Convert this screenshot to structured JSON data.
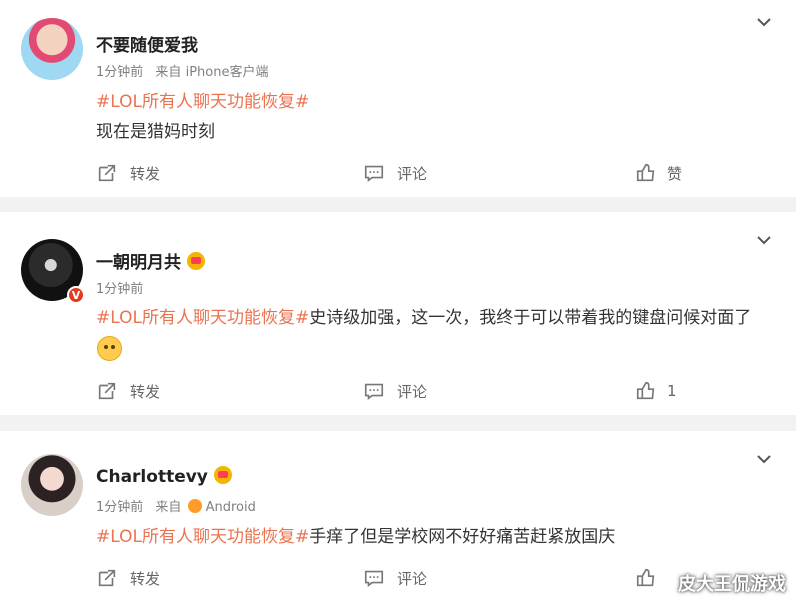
{
  "posts": [
    {
      "username": "不要随便爱我",
      "time": "1分钟前",
      "source_prefix": "来自",
      "source": "iPhone客户端",
      "hashtag": "#LOL所有人聊天功能恢复#",
      "body_after_hashtag": "",
      "body_line2": "现在是猎妈时刻",
      "actions": {
        "repost": "转发",
        "comment": "评论",
        "like": "赞"
      }
    },
    {
      "username": "一朝明月共",
      "time": "1分钟前",
      "hashtag": "#LOL所有人聊天功能恢复#",
      "body_after_hashtag": "史诗级加强，这一次，我终于可以带着我的键盘问候对面了",
      "actions": {
        "repost": "转发",
        "comment": "评论",
        "like": "1"
      }
    },
    {
      "username": "Charlottevy",
      "time": "1分钟前",
      "source_prefix": "来自",
      "source": "Android",
      "hashtag": "#LOL所有人聊天功能恢复#",
      "body_after_hashtag": "手痒了但是学校网不好好痛苦赶紧放国庆",
      "actions": {
        "repost": "转发",
        "comment": "评论",
        "like": ""
      }
    }
  ],
  "watermark": "皮大王侃游戏",
  "icons": {
    "menu": "chevron-down-icon",
    "repost": "share-icon",
    "comment": "comment-icon",
    "like": "thumbs-up-icon",
    "verified": "verified-badge-icon",
    "vip": "vip-badge-icon",
    "emoji": "doge-emoji-icon"
  },
  "colors": {
    "hashtag": "#eb7350",
    "background": "#f2f2f2",
    "card": "#ffffff"
  }
}
